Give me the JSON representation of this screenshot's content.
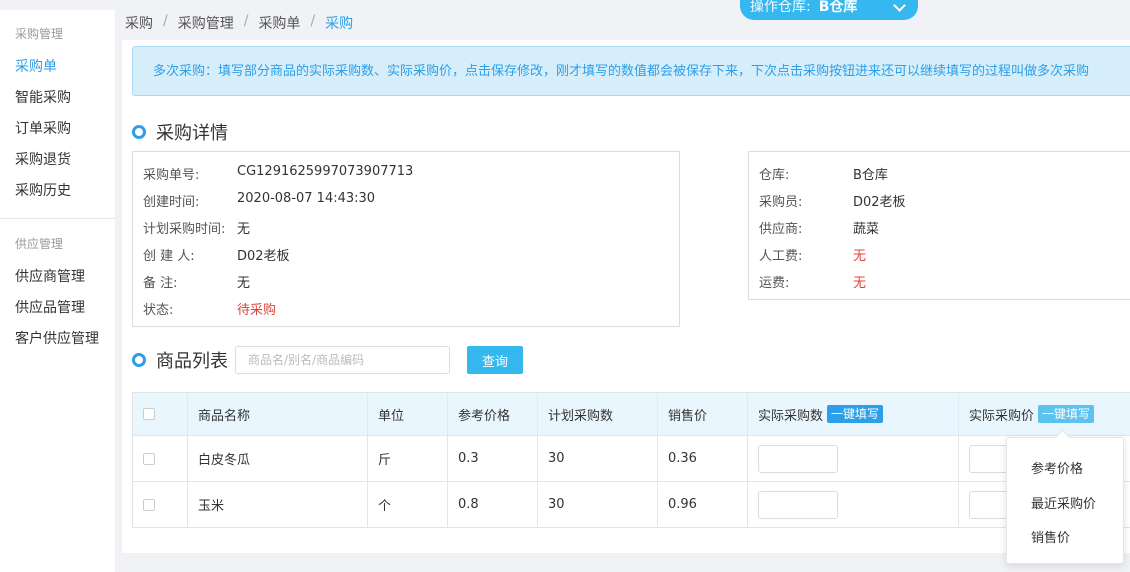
{
  "sidebar": {
    "groups": [
      {
        "title": "采购管理",
        "items": [
          "采购单",
          "智能采购",
          "订单采购",
          "采购退货",
          "采购历史"
        ]
      },
      {
        "title": "供应管理",
        "items": [
          "供应商管理",
          "供应品管理",
          "客户供应管理"
        ]
      }
    ]
  },
  "breadcrumb": [
    "采购",
    "采购管理",
    "采购单",
    "采购"
  ],
  "warehouse": {
    "label": "操作仓库:",
    "value": "B仓库"
  },
  "notice": "多次采购：填写部分商品的实际采购数、实际采购价，点击保存修改，刚才填写的数值都会被保存下来，下次点击采购按钮进来还可以继续填写的过程叫做多次采购",
  "detail": {
    "title": "采购详情",
    "left": [
      {
        "label": "采购单号:",
        "value": "CG1291625997073907713"
      },
      {
        "label": "创建时间:",
        "value": "2020-08-07 14:43:30"
      },
      {
        "label": "计划采购时间:",
        "value": "无"
      },
      {
        "label": "创 建 人:",
        "value": "D02老板"
      },
      {
        "label": "备 注:",
        "value": "无"
      },
      {
        "label": "状态:",
        "value": "待采购"
      }
    ],
    "right": [
      {
        "label": "仓库:",
        "value": "B仓库"
      },
      {
        "label": "采购员:",
        "value": "D02老板"
      },
      {
        "label": "供应商:",
        "value": "蔬菜"
      },
      {
        "label": "人工费:",
        "value": "无"
      },
      {
        "label": "运费:",
        "value": "无"
      }
    ]
  },
  "goods": {
    "title": "商品列表",
    "search_placeholder": "商品名/别名/商品编码",
    "search_button": "查询",
    "columns": [
      "商品名称",
      "单位",
      "参考价格",
      "计划采购数",
      "销售价",
      "实际采购数",
      "实际采购价"
    ],
    "fill_button": "一键填写",
    "rows": [
      {
        "name": "白皮冬瓜",
        "unit": "斤",
        "ref_price": "0.3",
        "plan_qty": "30",
        "sale_price": "0.36"
      },
      {
        "name": "玉米",
        "unit": "个",
        "ref_price": "0.8",
        "plan_qty": "30",
        "sale_price": "0.96"
      }
    ]
  },
  "dropdown": {
    "items": [
      "参考价格",
      "最近采购价",
      "销售价"
    ]
  },
  "colors": {
    "accent": "#2d9fe8",
    "warning": "#e0433a",
    "notice_bg": "#d6eefa"
  }
}
